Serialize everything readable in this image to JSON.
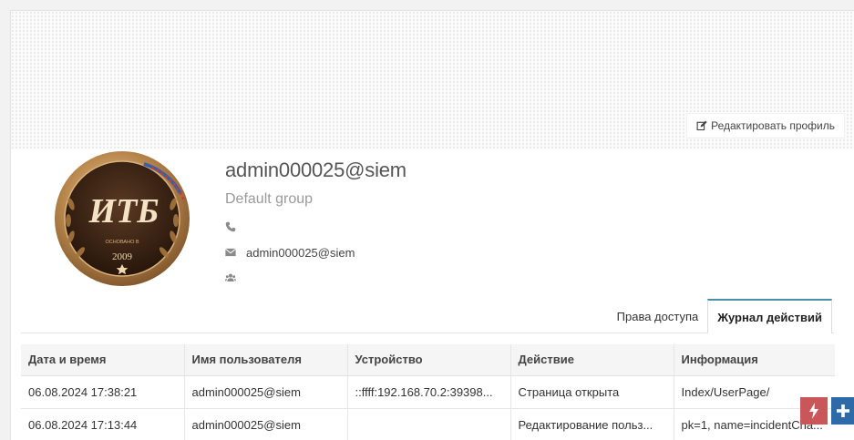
{
  "profile": {
    "edit_button_label": "Редактировать профиль",
    "username": "admin000025@siem",
    "group": "Default group",
    "phone": "",
    "email": "admin000025@siem",
    "avatar": {
      "logo_text": "ИТБ",
      "founded_label": "ОСНОВАНО В",
      "year": "2009"
    }
  },
  "tabs": [
    {
      "label": "Права доступа",
      "active": false
    },
    {
      "label": "Журнал действий",
      "active": true
    }
  ],
  "log_table": {
    "columns": [
      "Дата и время",
      "Имя пользователя",
      "Устройство",
      "Действие",
      "Информация"
    ],
    "rows": [
      [
        "06.08.2024 17:38:21",
        "admin000025@siem",
        "::ffff:192.168.70.2:39398...",
        "Страница открыта",
        "Index/UserPage/"
      ],
      [
        "06.08.2024 17:13:44",
        "admin000025@siem",
        "",
        "Редактирование польз...",
        "pk=1, name=incidentCha..."
      ]
    ]
  },
  "colors": {
    "accent_tab": "#4a8ea8",
    "float_red": "#c9575a",
    "float_blue": "#2e6aa8"
  },
  "icons": [
    "edit-icon",
    "phone-icon",
    "envelope-icon",
    "users-icon",
    "bolt-icon",
    "plus-icon"
  ]
}
